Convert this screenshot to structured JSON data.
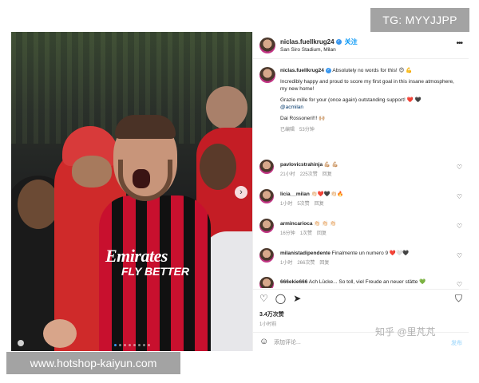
{
  "overlays": {
    "tg_badge": "TG: MYYJJPP",
    "url_badge": "www.hotshop-kaiyun.com",
    "watermark": "知乎 @里芃芃"
  },
  "photo": {
    "jersey_sponsor": "Emirates",
    "jersey_tagline": "FLY BETTER",
    "carousel_next_icon": "chevron-right-icon",
    "dots_count": 8
  },
  "post": {
    "header": {
      "username": "niclas.fuellkrug24",
      "follow_label": "关注",
      "location": "San Siro Stadium, Milan",
      "more_icon": "more-horizontal-icon"
    },
    "caption": {
      "username": "niclas.fuellkrug24",
      "line1": "Absolutely no words for this! 😍 💪",
      "paragraph1": "Incredibly happy and proud to score my first goal in this insane atmosphere, my new home!",
      "paragraph2_text": "Grazie mille for your (once again) outstanding support! ❤️ 🖤",
      "paragraph2_mention": "@acmilan",
      "paragraph3": "Dai Rossoneri!!! 🙌🏼",
      "time": "已编辑",
      "time2": "53分钟"
    },
    "comments": [
      {
        "username": "pavlovicstrahinja",
        "text": "💪🏼 💪🏼",
        "time": "21小时",
        "likes": "225次赞",
        "reply": "回复"
      },
      {
        "username": "licia__milan",
        "text": "👏🏻❤️🖤👏🏻🔥",
        "time": "1小时",
        "likes": "5次赞",
        "reply": "回复"
      },
      {
        "username": "armincarioca",
        "text": "👏🏻 👏🏻 👏🏻",
        "time": "16分钟",
        "likes": "1次赞",
        "reply": "回复"
      },
      {
        "username": "milanistadipendente",
        "text": "Finalmente un numero 9 ❤️🤍🖤",
        "time": "1小时",
        "likes": "266次赞",
        "reply": "回复"
      },
      {
        "username": "666ekie666",
        "text": "Ach Lücke... So toll, viel Freude an neuer stätte 💚",
        "time": "",
        "likes": "",
        "reply": ""
      }
    ],
    "actions": {
      "like_icon": "heart-icon",
      "comment_icon": "comment-icon",
      "share_icon": "send-icon",
      "save_icon": "bookmark-icon",
      "likes": "3.4万次赞",
      "date": "1小时前"
    },
    "add_comment": {
      "placeholder": "添加评论...",
      "post_label": "发布"
    }
  }
}
